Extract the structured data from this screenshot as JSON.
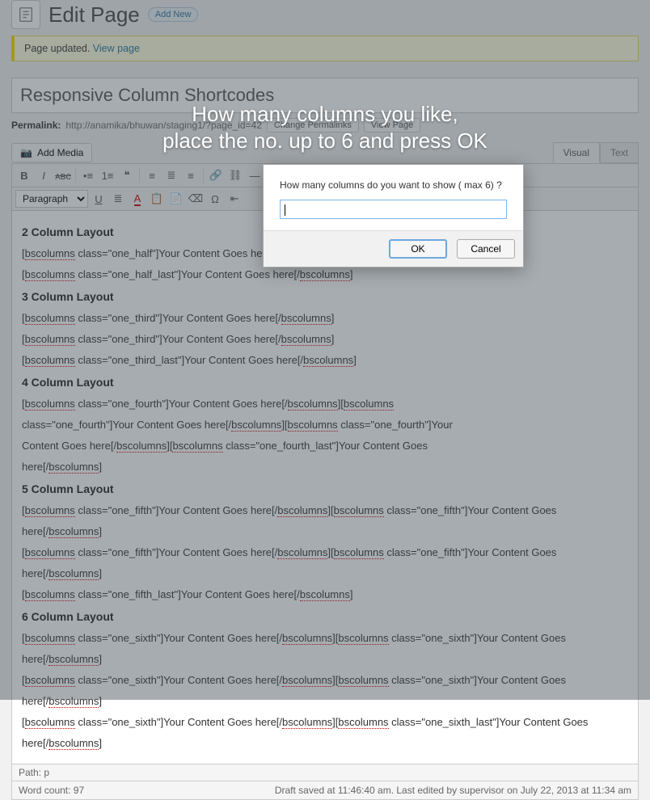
{
  "header": {
    "title": "Edit Page",
    "add_new": "Add New"
  },
  "notice": {
    "text": "Page updated. ",
    "link": "View page"
  },
  "post": {
    "title": "Responsive Column Shortcodes",
    "permalink_label": "Permalink:",
    "permalink_url": "http://anamika/bhuwan/staging1/?page_id=42",
    "change_btn": "Change Permalinks",
    "view_btn": "View Page"
  },
  "media": {
    "add": "Add Media"
  },
  "tabs": {
    "visual": "Visual",
    "text": "Text"
  },
  "format_select": "Paragraph",
  "callout": {
    "l1": "How many columns you like,",
    "l2": "place the no. up to 6 and press OK"
  },
  "modal": {
    "prompt": "How many columns do you want to show ( max 6) ?",
    "ok": "OK",
    "cancel": "Cancel"
  },
  "content": {
    "h2": "2 Column Layout",
    "l2a": "[bscolumns class=\"one_half\"]Your Content Goes here[/bscolumns]",
    "l2b": "[bscolumns class=\"one_half_last\"]Your Content Goes here[/bscolumns]",
    "h3": "3 Column Layout",
    "l3a": "[bscolumns class=\"one_third\"]Your Content Goes here[/bscolumns]",
    "l3b": "[bscolumns class=\"one_third\"]Your Content Goes here[/bscolumns]",
    "l3c": "[bscolumns class=\"one_third_last\"]Your Content Goes here[/bscolumns]",
    "h4": "4 Column Layout",
    "l4": "[bscolumns class=\"one_fourth\"]Your Content Goes here[/bscolumns][bscolumns class=\"one_fourth\"]Your Content Goes here[/bscolumns][bscolumns class=\"one_fourth\"]Your Content Goes here[/bscolumns][bscolumns class=\"one_fourth_last\"]Your Content Goes here[/bscolumns]",
    "h5": "5 Column Layout",
    "l5a": "[bscolumns class=\"one_fifth\"]Your Content Goes here[/bscolumns][bscolumns class=\"one_fifth\"]Your Content Goes here[/bscolumns]",
    "l5b": "[bscolumns class=\"one_fifth\"]Your Content Goes here[/bscolumns][bscolumns class=\"one_fifth\"]Your Content Goes here[/bscolumns]",
    "l5c": "[bscolumns class=\"one_fifth_last\"]Your Content Goes here[/bscolumns]",
    "h6": "6 Column Layout",
    "l6a": "[bscolumns class=\"one_sixth\"]Your Content Goes here[/bscolumns][bscolumns class=\"one_sixth\"]Your Content Goes here[/bscolumns]",
    "l6b": "[bscolumns class=\"one_sixth\"]Your Content Goes here[/bscolumns][bscolumns class=\"one_sixth\"]Your Content Goes here[/bscolumns]",
    "l6c": "[bscolumns class=\"one_sixth\"]Your Content Goes here[/bscolumns][bscolumns class=\"one_sixth_last\"]Your Content Goes here[/bscolumns]"
  },
  "path": {
    "label": "Path: p"
  },
  "status": {
    "wc": "Word count: 97",
    "draft": "Draft saved at 11:46:40 am. Last edited by supervisor on July 22, 2013 at 11:34 am"
  }
}
